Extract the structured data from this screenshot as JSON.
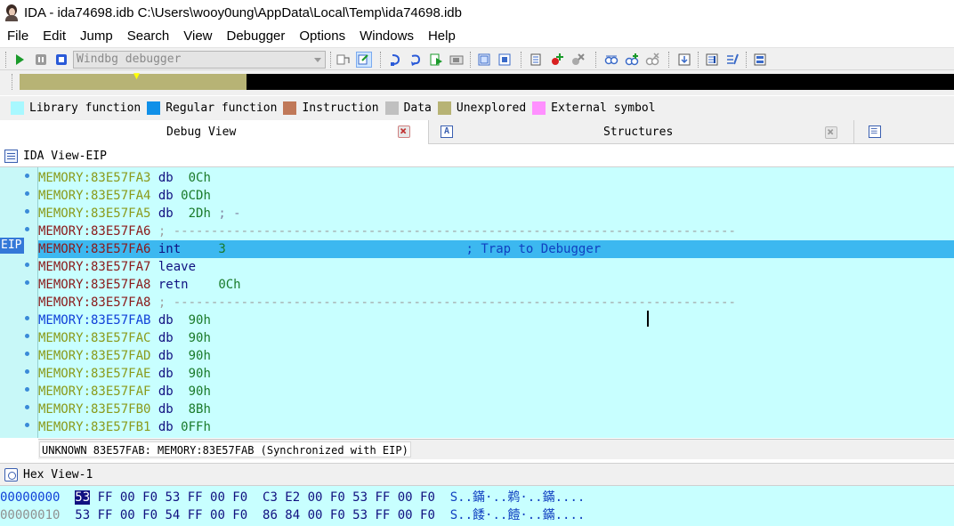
{
  "window": {
    "title": "IDA - ida74698.idb C:\\Users\\wooy0ung\\AppData\\Local\\Temp\\ida74698.idb"
  },
  "menu": [
    "File",
    "Edit",
    "Jump",
    "Search",
    "View",
    "Debugger",
    "Options",
    "Windows",
    "Help"
  ],
  "toolbar": {
    "debugger_select": "Windbg debugger",
    "icons": [
      "start-process-icon",
      "pause-icon",
      "stop-icon",
      "step-into-icon",
      "step-over-icon",
      "run-to-return-icon",
      "run-to-cursor-icon",
      "show-registers-icon",
      "breakpoint-list-icon",
      "add-breakpoint-icon",
      "delete-breakpoint-icon",
      "watch-view-icon",
      "add-watch-icon",
      "delete-watch-icon",
      "jump-icon",
      "trace-icon",
      "function-trace-icon",
      "tracing-window-icon"
    ]
  },
  "legend": [
    {
      "label": "Library function",
      "color": "#a8f8ff"
    },
    {
      "label": "Regular function",
      "color": "#1090e8"
    },
    {
      "label": "Instruction",
      "color": "#c07858"
    },
    {
      "label": "Data",
      "color": "#c0c0c0"
    },
    {
      "label": "Unexplored",
      "color": "#b7b375"
    },
    {
      "label": "External symbol",
      "color": "#ff90ff"
    }
  ],
  "tabs": {
    "debug_view": "Debug View",
    "structures": "Structures"
  },
  "ida_view": {
    "title": "IDA View-EIP",
    "eip_label": "EIP",
    "lines": [
      {
        "addr": "MEMORY:83E57FA3",
        "op": "db",
        "arg": "0Ch",
        "comment": "",
        "addr_type": "unexp"
      },
      {
        "addr": "MEMORY:83E57FA4",
        "op": "db",
        "arg": "0CDh",
        "comment": "",
        "addr_type": "unexp"
      },
      {
        "addr": "MEMORY:83E57FA5",
        "op": "db",
        "arg": "2Dh",
        "comment": "; -",
        "addr_type": "unexp"
      },
      {
        "addr": "MEMORY:83E57FA6",
        "op": "",
        "arg": "",
        "comment": "; ---------------------------------------------------------------------------",
        "addr_type": "code"
      },
      {
        "addr": "MEMORY:83E57FA6",
        "op": "int",
        "arg": "3",
        "comment": "; Trap to Debugger",
        "addr_type": "code"
      },
      {
        "addr": "MEMORY:83E57FA7",
        "op": "leave",
        "arg": "",
        "comment": "",
        "addr_type": "code"
      },
      {
        "addr": "MEMORY:83E57FA8",
        "op": "retn",
        "arg": "0Ch",
        "comment": "",
        "addr_type": "code"
      },
      {
        "addr": "MEMORY:83E57FA8",
        "op": "",
        "arg": "",
        "comment": "; ---------------------------------------------------------------------------",
        "addr_type": "code"
      },
      {
        "addr": "MEMORY:83E57FAB",
        "op": "db",
        "arg": "90h",
        "comment": "",
        "addr_type": "data"
      },
      {
        "addr": "MEMORY:83E57FAC",
        "op": "db",
        "arg": "90h",
        "comment": "",
        "addr_type": "unexp"
      },
      {
        "addr": "MEMORY:83E57FAD",
        "op": "db",
        "arg": "90h",
        "comment": "",
        "addr_type": "unexp"
      },
      {
        "addr": "MEMORY:83E57FAE",
        "op": "db",
        "arg": "90h",
        "comment": "",
        "addr_type": "unexp"
      },
      {
        "addr": "MEMORY:83E57FAF",
        "op": "db",
        "arg": "90h",
        "comment": "",
        "addr_type": "unexp"
      },
      {
        "addr": "MEMORY:83E57FB0",
        "op": "db",
        "arg": "8Bh",
        "comment": "",
        "addr_type": "unexp"
      },
      {
        "addr": "MEMORY:83E57FB1",
        "op": "db",
        "arg": "0FFh",
        "comment": "",
        "addr_type": "unexp"
      }
    ],
    "status": "UNKNOWN 83E57FAB: MEMORY:83E57FAB (Synchronized with EIP)"
  },
  "hex_view": {
    "title": "Hex View-1",
    "rows": [
      {
        "addr": "00000000",
        "first_byte": "53",
        "bytes": "FF 00 F0 53 FF 00 F0  C3 E2 00 F0 53 FF 00 F0",
        "ascii": "S..鏋·..鹈·..鏋...."
      },
      {
        "addr": "00000010",
        "first_byte": "53",
        "bytes": "FF 00 F0 54 FF 00 F0  86 84 00 F0 53 FF 00 F0",
        "ascii": "S..餧·..饐·..鏋...."
      }
    ]
  }
}
